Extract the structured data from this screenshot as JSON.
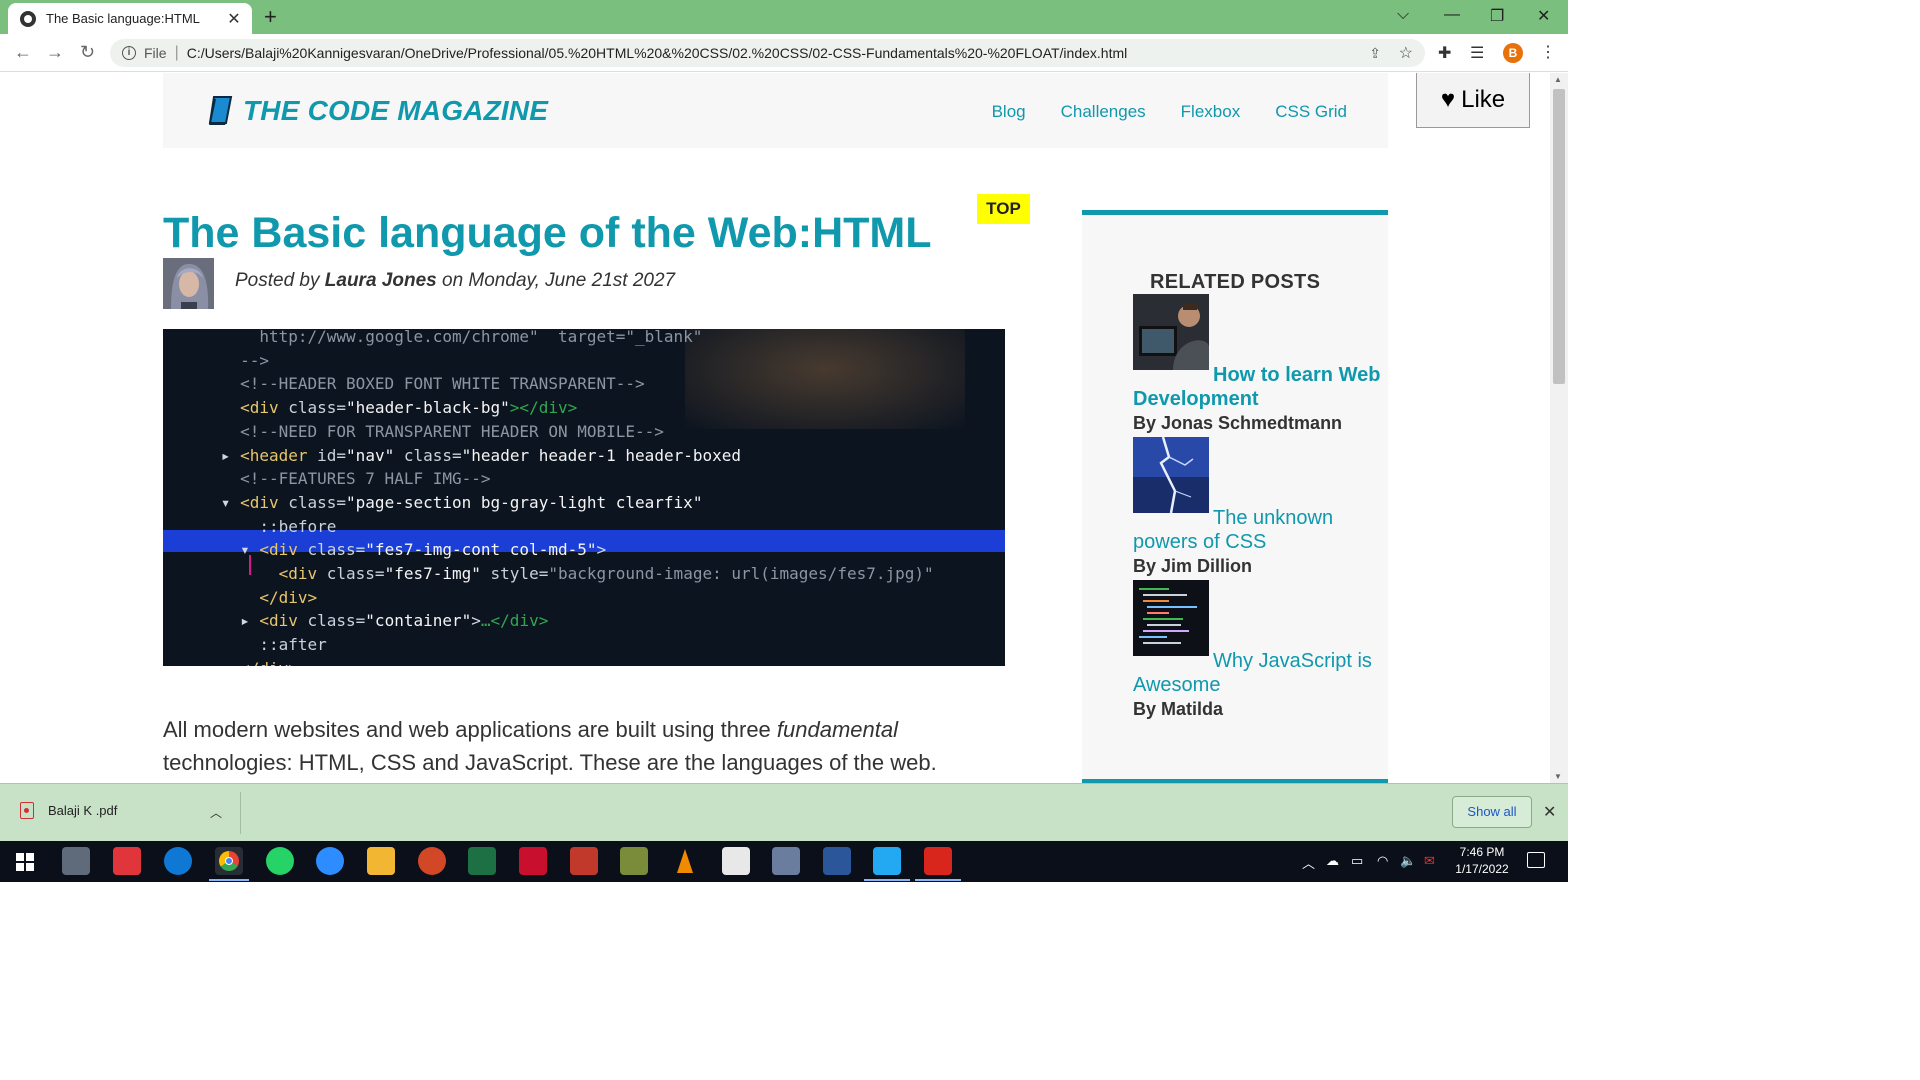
{
  "browser": {
    "tab_title": "The Basic language:HTML",
    "scheme_label": "File",
    "url": "C:/Users/Balaji%20Kannigesvaran/OneDrive/Professional/05.%20HTML%20&%20CSS/02.%20CSS/02-CSS-Fundamentals%20-%20FLOAT/index.html",
    "profile_initial": "B"
  },
  "site": {
    "logo_text": "THE CODE MAGAZINE",
    "nav": [
      "Blog",
      "Challenges",
      "Flexbox",
      "CSS Grid"
    ],
    "like_label": "Like",
    "top_badge": "TOP"
  },
  "post": {
    "title": "The Basic language of the Web:HTML",
    "byline_prefix": "Posted by",
    "author": "Laura Jones",
    "byline_date": "on Monday, June 21st 2027",
    "intro_1": "All modern websites and web applications are built using three ",
    "intro_em": "fundamental",
    "intro_2": " technologies: HTML, CSS and JavaScript. These are the languages of the web."
  },
  "sidebar": {
    "heading": "RELATED POSTS",
    "posts": [
      {
        "title": "How to learn Web Development",
        "author": "By Jonas Schmedtmann"
      },
      {
        "title": "The unknown powers of CSS",
        "author": "By Jim Dillion"
      },
      {
        "title": "Why JavaScript is Awesome",
        "author": "By Matilda"
      }
    ]
  },
  "downloads": {
    "file_name": "Balaji K .pdf",
    "show_all": "Show all"
  },
  "taskbar": {
    "time": "7:46 PM",
    "date": "1/17/2022"
  },
  "colors": {
    "accent": "#1098ad",
    "tabbar": "#7bbf7f",
    "badge": "#ffff00"
  }
}
